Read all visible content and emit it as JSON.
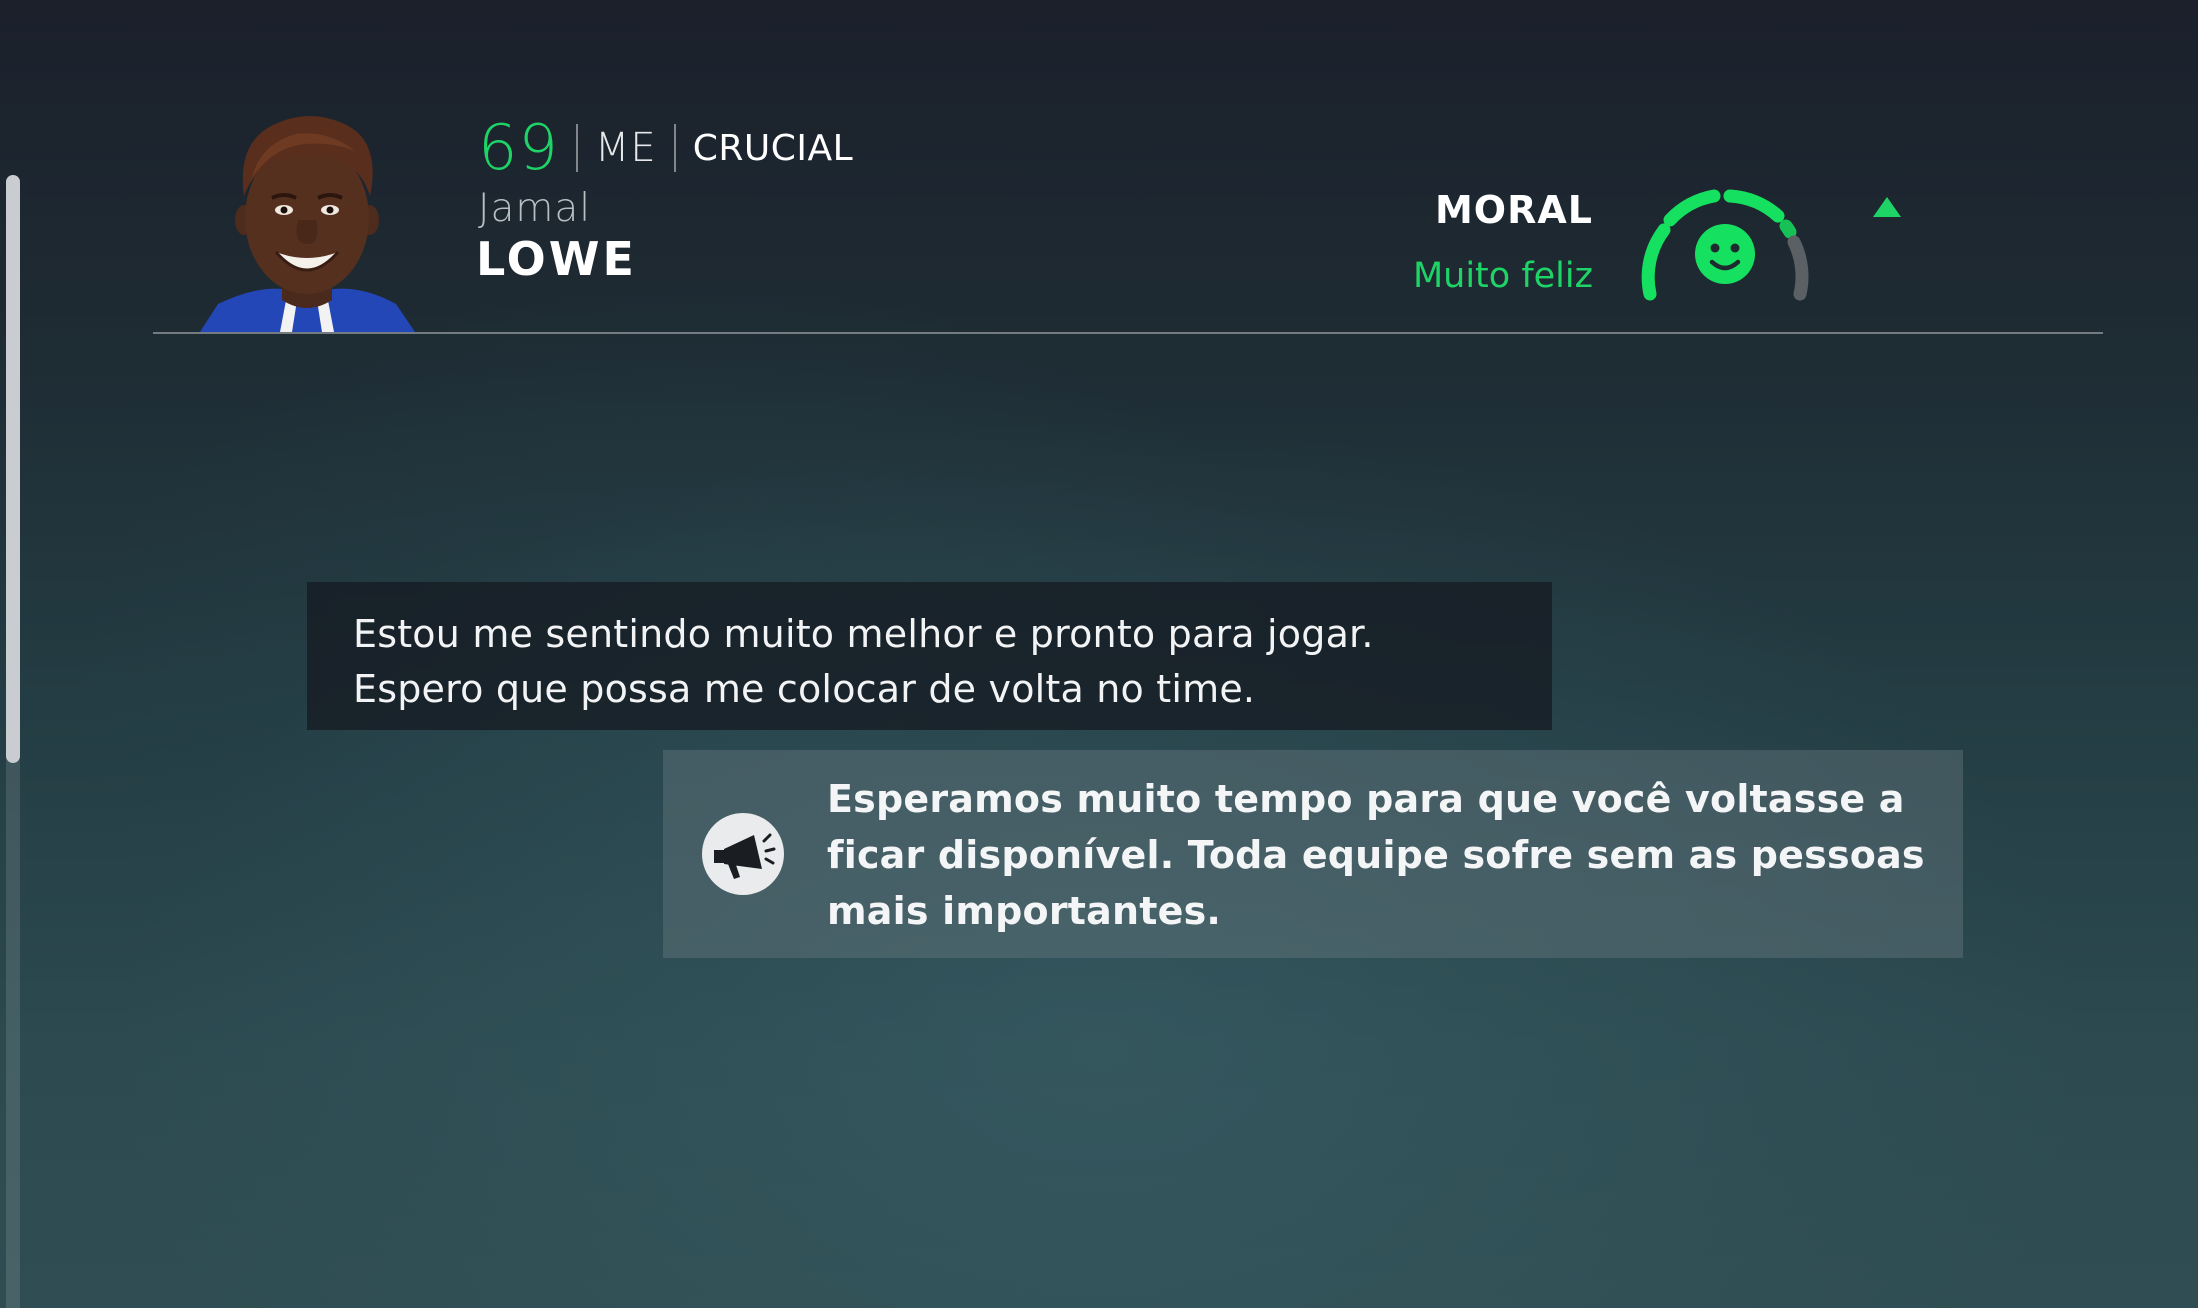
{
  "player": {
    "rating": "69",
    "position": "ME",
    "role": "CRUCIAL",
    "first_name": "Jamal",
    "last_name": "LOWE"
  },
  "morale": {
    "label": "MORAL",
    "status": "Muito feliz",
    "level": 0.8,
    "trend": "up",
    "color": "#1fd467"
  },
  "conversation": {
    "player_message": "Estou me sentindo muito melhor e pronto para jogar. Espero que possa me colocar de volta no time.",
    "manager_response": "Esperamos muito tempo para que você voltasse a ficar disponível. Toda equipe sofre sem as pessoas mais importantes.",
    "response_icon": "megaphone-icon"
  },
  "colors": {
    "accent": "#1fd467",
    "player_bubble": "#161b22",
    "manager_bubble": "#697a80"
  }
}
